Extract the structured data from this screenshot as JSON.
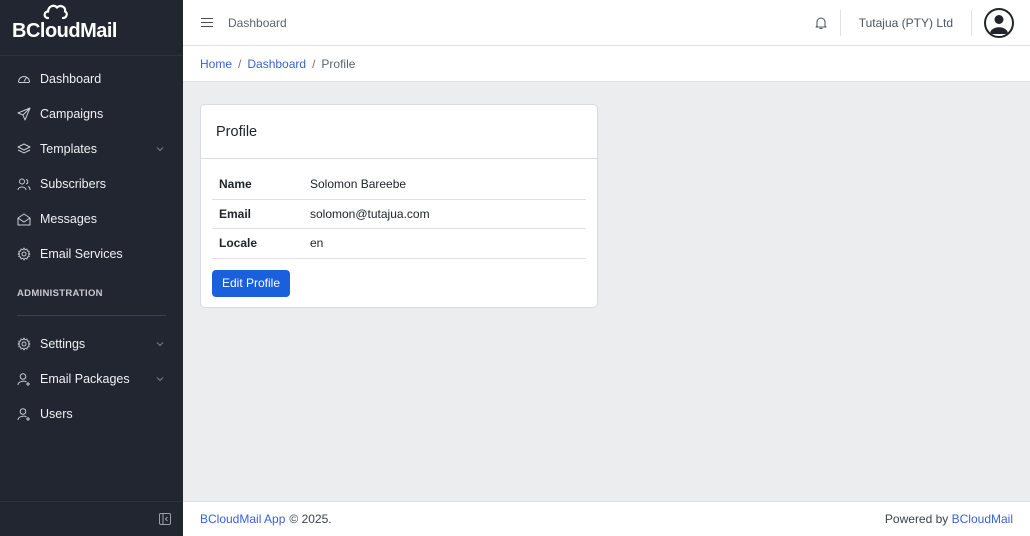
{
  "brand": {
    "name": "BCloudMail"
  },
  "sidebar": {
    "items": [
      {
        "label": "Dashboard",
        "icon": "speedometer-icon"
      },
      {
        "label": "Campaigns",
        "icon": "send-icon"
      },
      {
        "label": "Templates",
        "icon": "layers-icon",
        "has_children": true
      },
      {
        "label": "Subscribers",
        "icon": "people-icon"
      },
      {
        "label": "Messages",
        "icon": "envelope-open-icon"
      },
      {
        "label": "Email Services",
        "icon": "cog-icon"
      }
    ],
    "section_title": "ADMINISTRATION",
    "admin_items": [
      {
        "label": "Settings",
        "icon": "cog-icon",
        "has_children": true
      },
      {
        "label": "Email Packages",
        "icon": "user-plus-icon",
        "has_children": true
      },
      {
        "label": "Users",
        "icon": "user-plus-icon"
      }
    ]
  },
  "header": {
    "link": "Dashboard",
    "company": "Tutajua (PTY) Ltd"
  },
  "breadcrumb": {
    "home": "Home",
    "separator": "/",
    "dashboard": "Dashboard",
    "current": "Profile"
  },
  "profile": {
    "title": "Profile",
    "fields": [
      {
        "label": "Name",
        "value": "Solomon Bareebe"
      },
      {
        "label": "Email",
        "value": "solomon@tutajua.com"
      },
      {
        "label": "Locale",
        "value": "en"
      }
    ],
    "edit_button": "Edit Profile"
  },
  "footer": {
    "app_link": "BCloudMail App",
    "copyright": "© 2025.",
    "powered_by": "Powered by",
    "powered_link": "BCloudMail"
  },
  "colors": {
    "sidebar_bg": "#212631",
    "primary": "#1a5fdc",
    "link": "#3a62d8",
    "page_bg": "#ebedef"
  }
}
